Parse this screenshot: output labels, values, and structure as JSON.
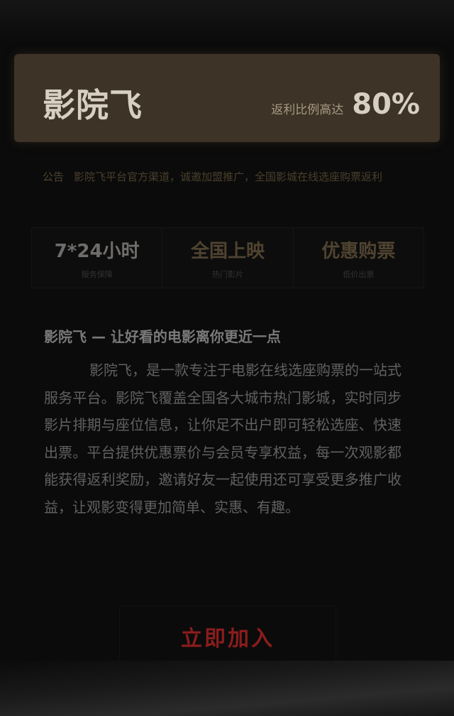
{
  "header": {
    "title": "影院飞",
    "subtitle": "返利比例高达",
    "percent": "80%"
  },
  "notice": {
    "tag": "公告",
    "text": "影院飞平台官方渠道，诚邀加盟推广，全国影城在线选座购票返利"
  },
  "stats": [
    {
      "value": "7*24小时",
      "label": "服务保障"
    },
    {
      "value": "全国上映",
      "label": "热门影片"
    },
    {
      "value": "优惠购票",
      "label": "低价出票"
    }
  ],
  "content": {
    "heading": "影院飞 — 让好看的电影离你更近一点",
    "tail": "",
    "paragraph": "影院飞，是一款专注于电影在线选座购票的一站式服务平台。影院飞覆盖全国各大城市热门影城，实时同步影片排期与座位信息，让你足不出户即可轻松选座、快速出票。平台提供优惠票价与会员专享权益，每一次观影都能获得返利奖励，邀请好友一起使用还可享受更多推广收益，让观影变得更加简单、实惠、有趣。"
  },
  "cta": {
    "label": "立即加入"
  }
}
